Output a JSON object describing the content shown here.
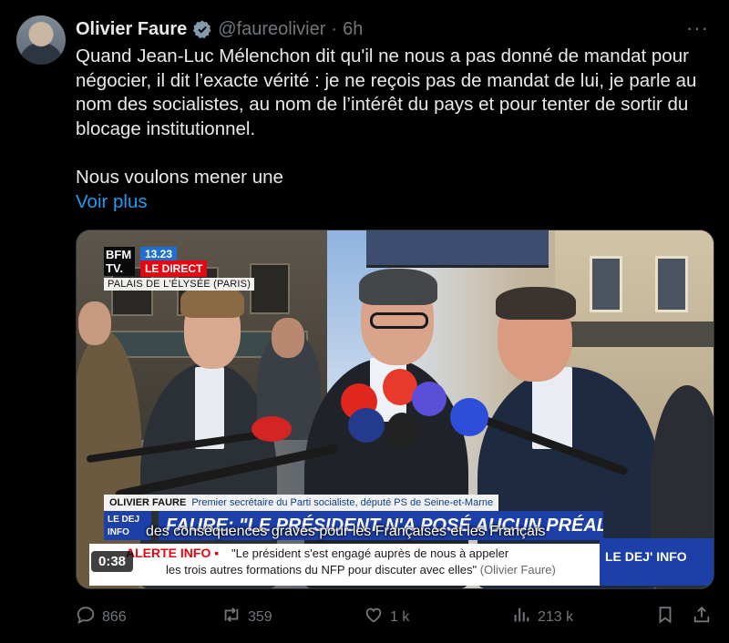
{
  "author": {
    "name": "Olivier Faure",
    "handle": "@faureolivier",
    "separator": "·",
    "time": "6h"
  },
  "more_icon": "···",
  "body": {
    "paragraph1": "Quand Jean-Luc Mélenchon dit qu'il ne nous a pas donné de mandat pour négocier, il dit l’exacte vérité : je ne reçois pas de mandat de lui, je parle au nom des socialistes, au nom de l’intérêt du pays et pour tenter de sortir du blocage institutionnel.",
    "paragraph2": "Nous voulons mener une",
    "show_more": "Voir plus"
  },
  "video": {
    "duration": "0:38",
    "overlay": {
      "channel_logo": "BFM TV.",
      "live_time": "13.23",
      "live_label": "LE DIRECT",
      "location": "PALAIS DE L'ÉLYSÉE (PARIS)",
      "speaker_name": "OLIVIER FAURE",
      "speaker_role": "Premier secrétaire du Parti socialiste, député PS de Seine-et-Marne",
      "ledirect_box": "LE DEJ INFO",
      "headline": "FAURE: \"LE PRÉSIDENT N'A POSÉ AUCUN PRÉALABLE\"",
      "subtitle": "des conséquences graves pour les Françaises et les Français",
      "alert_label": "ALERTE INFO ▪",
      "alert_line1": "\"Le président s'est engagé auprès de nous à appeler",
      "alert_line2": "les trois autres formations du NFP pour discuter avec elles\"",
      "alert_source": "(Olivier Faure)",
      "right_box": "LE DEJ' INFO"
    }
  },
  "actions": {
    "replies": "866",
    "reposts": "359",
    "likes": "1 k",
    "views": "213 k"
  },
  "colors": {
    "background": "#000000",
    "text": "#e7e9ea",
    "muted": "#71767b",
    "link": "#1d9bf0",
    "verified": "#829aab"
  }
}
